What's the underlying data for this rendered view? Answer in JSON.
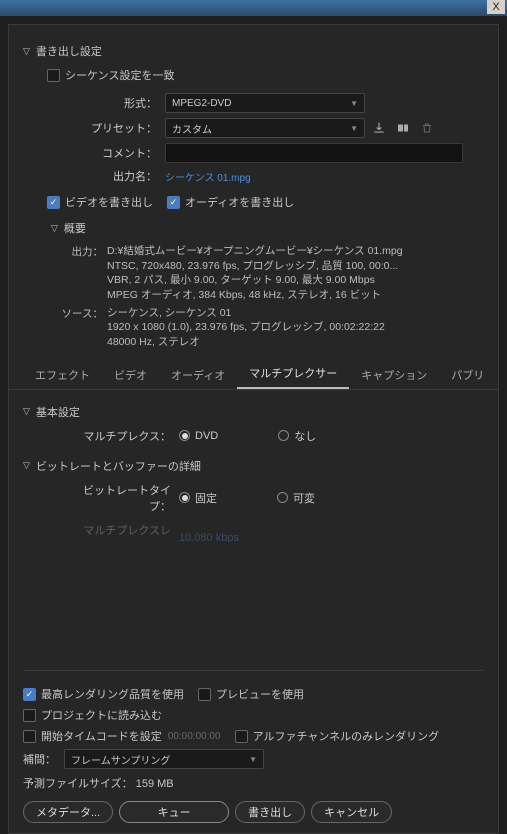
{
  "titlebar": {
    "close": "X"
  },
  "export": {
    "section_title": "書き出し設定",
    "match_sequence": "シーケンス設定を一致",
    "format_label": "形式：",
    "format_value": "MPEG2-DVD",
    "preset_label": "プリセット：",
    "preset_value": "カスタム",
    "comment_label": "コメント：",
    "outname_label": "出力名：",
    "outname_value": "シーケンス 01.mpg",
    "export_video": "ビデオを書き出し",
    "export_audio": "オーディオを書き出し"
  },
  "summary": {
    "section_title": "概要",
    "out_label": "出力：",
    "out_lines": [
      "D:¥結婚式ムービー¥オープニングムービー¥シーケンス 01.mpg",
      "NTSC, 720x480, 23.976 fps, プログレッシブ, 品質 100, 00:0...",
      "VBR, 2 パス, 最小 9.00, ターゲット 9.00, 最大 9.00 Mbps",
      "MPEG オーディオ, 384 Kbps, 48 kHz, ステレオ, 16 ビット"
    ],
    "src_label": "ソース：",
    "src_lines": [
      "シーケンス, シーケンス 01",
      "1920 x 1080 (1.0), 23.976 fps, プログレッシブ, 00:02:22:22",
      "48000 Hz, ステレオ"
    ]
  },
  "tabs": {
    "effects": "エフェクト",
    "video": "ビデオ",
    "audio": "オーディオ",
    "multiplexer": "マルチプレクサー",
    "captions": "キャプション",
    "publish": "パブリ"
  },
  "mux": {
    "basic_section": "基本設定",
    "mux_label": "マルチプレクス：",
    "opt_dvd": "DVD",
    "opt_none": "なし",
    "bitrate_section": "ビットレートとバッファーの詳細",
    "bitrate_type_label": "ビットレートタイプ：",
    "opt_fixed": "固定",
    "opt_variable": "可変",
    "muxrate_label": "マルチプレクスレート：",
    "muxrate_value": "10.080 kbps"
  },
  "bottom": {
    "max_quality": "最高レンダリング品質を使用",
    "use_previews": "プレビューを使用",
    "import_project": "プロジェクトに読み込む",
    "set_timecode": "開始タイムコードを設定",
    "timecode_value": "00:00:00:00",
    "alpha_only": "アルファチャンネルのみレンダリング",
    "interp_label": "補間：",
    "interp_value": "フレームサンプリング",
    "filesize_label": "予測ファイルサイズ：",
    "filesize_value": "159 MB",
    "btn_metadata": "メタデータ...",
    "btn_queue": "キュー",
    "btn_export": "書き出し",
    "btn_cancel": "キャンセル"
  }
}
